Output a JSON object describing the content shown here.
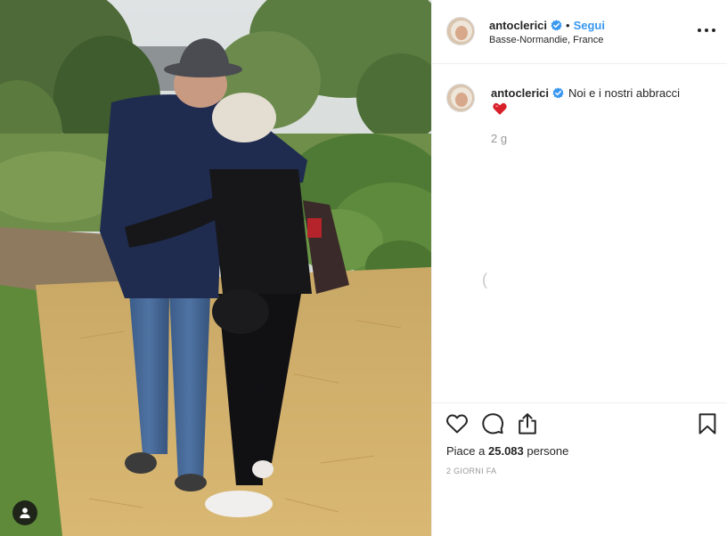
{
  "post": {
    "author": {
      "username": "antoclerici",
      "verified": true,
      "location": "Basse-Normandie, France"
    },
    "header": {
      "separator": "•",
      "follow_label": "Segui"
    },
    "caption": {
      "username": "antoclerici",
      "text": "Noi e i nostri abbracci",
      "emoji": "red-heart"
    },
    "comment_age": "2 g",
    "loading_glyph": "(",
    "likes": {
      "prefix": "Piace a",
      "count": "25.083",
      "suffix": "persone"
    },
    "date": "2 GIORNI FA",
    "icons": {
      "like": "heart-outline-icon",
      "comment": "speech-bubble-icon",
      "share": "share-upload-icon",
      "save": "bookmark-icon",
      "more": "ellipsis-icon",
      "tags": "user-tag-icon",
      "verified": "verified-badge-icon"
    },
    "colors": {
      "link_blue": "#3897f0",
      "verified_blue": "#3897f0",
      "text": "#262626",
      "muted": "#999999",
      "border": "#efefef",
      "heart_red": "#ed4956"
    }
  }
}
